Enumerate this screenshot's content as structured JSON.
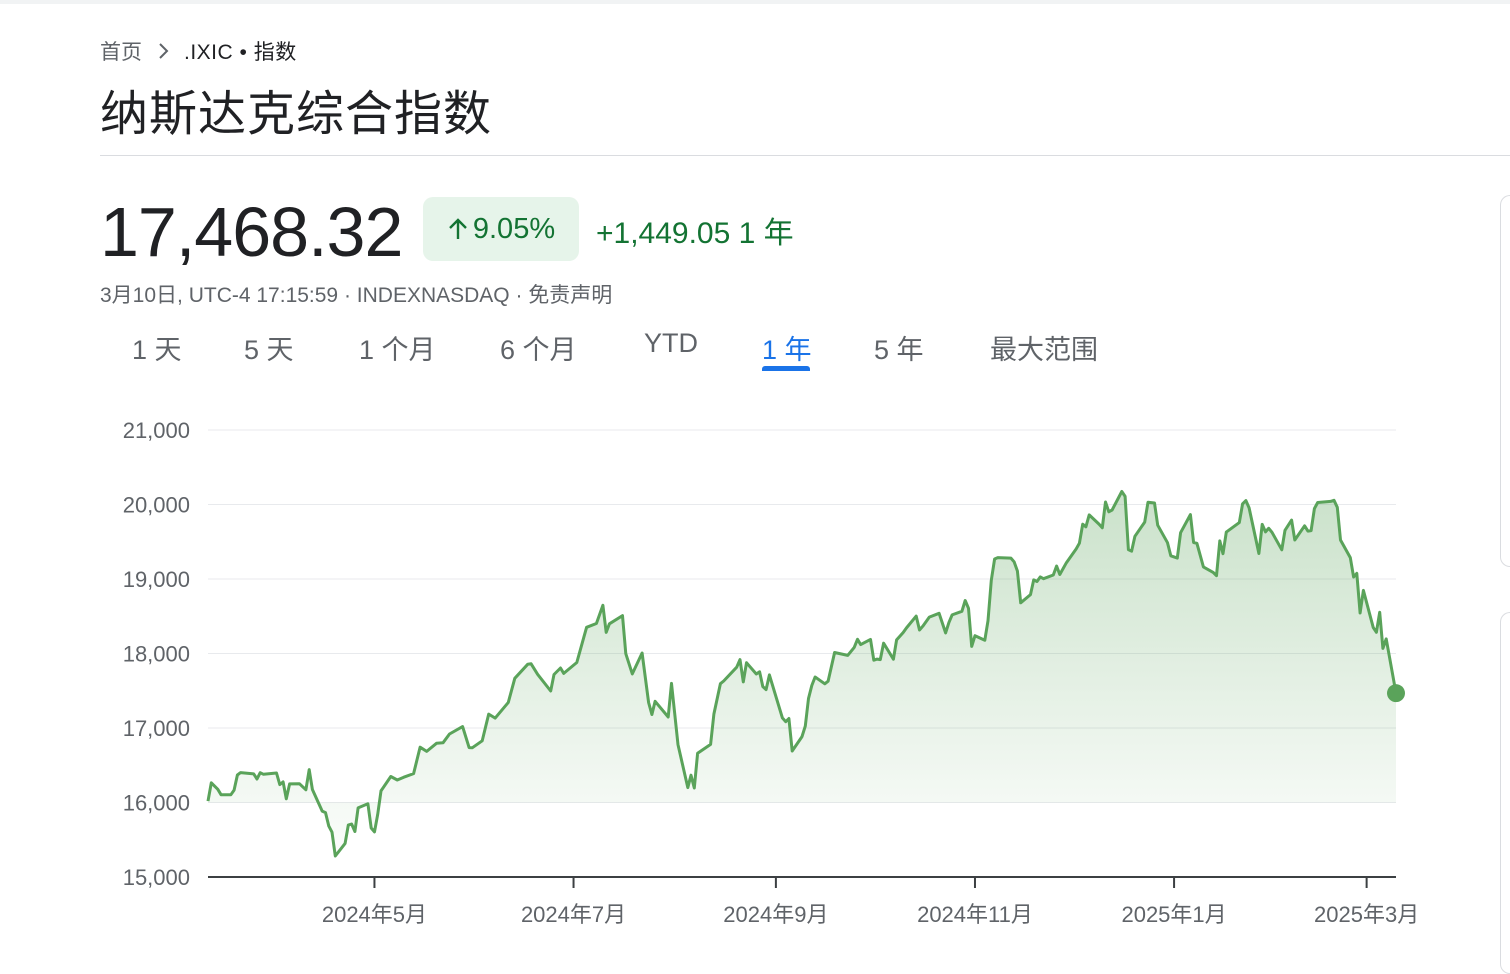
{
  "breadcrumb": {
    "home": "首页",
    "current": ".IXIC • 指数"
  },
  "title": "纳斯达克综合指数",
  "quote": {
    "price": "17,468.32",
    "change_percent": "9.05%",
    "change_abs": "+1,449.05",
    "period": "1 年",
    "meta": "3月10日, UTC-4 17:15:59 · INDEXNASDAQ · 免责声明"
  },
  "tabs": [
    {
      "label": "1 天"
    },
    {
      "label": "5 天"
    },
    {
      "label": "1 个月"
    },
    {
      "label": "6 个月"
    },
    {
      "label": "YTD"
    },
    {
      "label": "1 年",
      "active": true
    },
    {
      "label": "5 年"
    },
    {
      "label": "最大范围"
    }
  ],
  "colors": {
    "up": "#137333",
    "line": "#5aa35a",
    "accent": "#1a73e8",
    "pill_bg": "#e6f4ea"
  },
  "icons": {
    "breadcrumb_sep": "chevron-right-icon",
    "trend": "arrow-up-icon"
  },
  "chart_data": {
    "type": "area",
    "ylim": [
      15000,
      21000
    ],
    "yticks": [
      21000,
      20000,
      19000,
      18000,
      17000,
      16000,
      15000
    ],
    "ytick_labels": [
      "21,000",
      "20,000",
      "19,000",
      "18,000",
      "17,000",
      "16,000",
      "15,000"
    ],
    "xticks": [
      {
        "date": "2024-05-01",
        "label": "2024年5月"
      },
      {
        "date": "2024-07-01",
        "label": "2024年7月"
      },
      {
        "date": "2024-09-01",
        "label": "2024年9月"
      },
      {
        "date": "2024-11-01",
        "label": "2024年11月"
      },
      {
        "date": "2025-01-01",
        "label": "2025年1月"
      },
      {
        "date": "2025-03-01",
        "label": "2025年3月"
      }
    ],
    "grid": true,
    "series": [
      {
        "points": [
          [
            "2024-03-11",
            16019
          ],
          [
            "2024-03-12",
            16265
          ],
          [
            "2024-03-14",
            16177
          ],
          [
            "2024-03-15",
            16103
          ],
          [
            "2024-03-18",
            16103
          ],
          [
            "2024-03-19",
            16166
          ],
          [
            "2024-03-20",
            16369
          ],
          [
            "2024-03-21",
            16401
          ],
          [
            "2024-03-25",
            16384
          ],
          [
            "2024-03-26",
            16316
          ],
          [
            "2024-03-27",
            16400
          ],
          [
            "2024-03-28",
            16379
          ],
          [
            "2024-04-01",
            16396
          ],
          [
            "2024-04-02",
            16240
          ],
          [
            "2024-04-03",
            16277
          ],
          [
            "2024-04-04",
            16049
          ],
          [
            "2024-04-05",
            16249
          ],
          [
            "2024-04-08",
            16253
          ],
          [
            "2024-04-10",
            16170
          ],
          [
            "2024-04-11",
            16442
          ],
          [
            "2024-04-12",
            16175
          ],
          [
            "2024-04-15",
            15885
          ],
          [
            "2024-04-16",
            15865
          ],
          [
            "2024-04-17",
            15683
          ],
          [
            "2024-04-18",
            15601
          ],
          [
            "2024-04-19",
            15282
          ],
          [
            "2024-04-22",
            15451
          ],
          [
            "2024-04-23",
            15697
          ],
          [
            "2024-04-24",
            15712
          ],
          [
            "2024-04-25",
            15611
          ],
          [
            "2024-04-26",
            15928
          ],
          [
            "2024-04-29",
            15983
          ],
          [
            "2024-04-30",
            15658
          ],
          [
            "2024-05-01",
            15605
          ],
          [
            "2024-05-02",
            15840
          ],
          [
            "2024-05-03",
            16156
          ],
          [
            "2024-05-06",
            16349
          ],
          [
            "2024-05-08",
            16302
          ],
          [
            "2024-05-10",
            16340
          ],
          [
            "2024-05-13",
            16388
          ],
          [
            "2024-05-15",
            16742
          ],
          [
            "2024-05-17",
            16686
          ],
          [
            "2024-05-20",
            16795
          ],
          [
            "2024-05-22",
            16801
          ],
          [
            "2024-05-24",
            16920
          ],
          [
            "2024-05-28",
            17019
          ],
          [
            "2024-05-30",
            16737
          ],
          [
            "2024-05-31",
            16735
          ],
          [
            "2024-06-03",
            16828
          ],
          [
            "2024-06-05",
            17187
          ],
          [
            "2024-06-07",
            17133
          ],
          [
            "2024-06-11",
            17343
          ],
          [
            "2024-06-13",
            17667
          ],
          [
            "2024-06-17",
            17857
          ],
          [
            "2024-06-18",
            17862
          ],
          [
            "2024-06-20",
            17721
          ],
          [
            "2024-06-24",
            17497
          ],
          [
            "2024-06-25",
            17718
          ],
          [
            "2024-06-27",
            17805
          ],
          [
            "2024-06-28",
            17733
          ],
          [
            "2024-07-02",
            17879
          ],
          [
            "2024-07-05",
            18352
          ],
          [
            "2024-07-08",
            18403
          ],
          [
            "2024-07-10",
            18647
          ],
          [
            "2024-07-11",
            18283
          ],
          [
            "2024-07-12",
            18398
          ],
          [
            "2024-07-16",
            18509
          ],
          [
            "2024-07-17",
            17997
          ],
          [
            "2024-07-19",
            17726
          ],
          [
            "2024-07-22",
            18007
          ],
          [
            "2024-07-24",
            17342
          ],
          [
            "2024-07-25",
            17181
          ],
          [
            "2024-07-26",
            17358
          ],
          [
            "2024-07-30",
            17147
          ],
          [
            "2024-07-31",
            17599
          ],
          [
            "2024-08-01",
            17194
          ],
          [
            "2024-08-02",
            16776
          ],
          [
            "2024-08-05",
            16200
          ],
          [
            "2024-08-06",
            16366
          ],
          [
            "2024-08-07",
            16195
          ],
          [
            "2024-08-08",
            16660
          ],
          [
            "2024-08-12",
            16780
          ],
          [
            "2024-08-13",
            17188
          ],
          [
            "2024-08-15",
            17594
          ],
          [
            "2024-08-16",
            17631
          ],
          [
            "2024-08-20",
            17816
          ],
          [
            "2024-08-21",
            17918
          ],
          [
            "2024-08-22",
            17619
          ],
          [
            "2024-08-23",
            17877
          ],
          [
            "2024-08-26",
            17725
          ],
          [
            "2024-08-27",
            17754
          ],
          [
            "2024-08-28",
            17556
          ],
          [
            "2024-08-29",
            17516
          ],
          [
            "2024-08-30",
            17713
          ],
          [
            "2024-09-03",
            17136
          ],
          [
            "2024-09-04",
            17084
          ],
          [
            "2024-09-05",
            17128
          ],
          [
            "2024-09-06",
            16691
          ],
          [
            "2024-09-09",
            16885
          ],
          [
            "2024-09-10",
            17026
          ],
          [
            "2024-09-11",
            17396
          ],
          [
            "2024-09-12",
            17570
          ],
          [
            "2024-09-13",
            17684
          ],
          [
            "2024-09-16",
            17593
          ],
          [
            "2024-09-17",
            17628
          ],
          [
            "2024-09-18], 17574"
          ],
          [
            "2024-09-19",
            18014
          ],
          [
            "2024-09-23",
            17974
          ],
          [
            "2024-09-25",
            18082
          ],
          [
            "2024-09-26",
            18190
          ],
          [
            "2024-09-27",
            18119
          ],
          [
            "2024-09-30",
            18189
          ],
          [
            "2024-10-01",
            17910
          ],
          [
            "2024-10-02",
            17925
          ],
          [
            "2024-10-03",
            17918
          ],
          [
            "2024-10-04",
            18138
          ],
          [
            "2024-10-07",
            17923
          ],
          [
            "2024-10-08",
            18182
          ],
          [
            "2024-10-10",
            18282
          ],
          [
            "2024-10-11",
            18342
          ],
          [
            "2024-10-14",
            18502
          ],
          [
            "2024-10-15",
            18315
          ],
          [
            "2024-10-16",
            18367
          ],
          [
            "2024-10-18",
            18489
          ],
          [
            "2024-10-21",
            18540
          ],
          [
            "2024-10-23",
            18276
          ],
          [
            "2024-10-24",
            18415
          ],
          [
            "2024-10-25",
            18518
          ],
          [
            "2024-10-28",
            18567
          ],
          [
            "2024-10-29",
            18712
          ],
          [
            "2024-10-30",
            18607
          ],
          [
            "2024-10-31",
            18095
          ],
          [
            "2024-11-01",
            18239
          ],
          [
            "2024-11-04",
            18179
          ],
          [
            "2024-11-05",
            18439
          ],
          [
            "2024-11-06",
            18983
          ],
          [
            "2024-11-07",
            19269
          ],
          [
            "2024-11-08",
            19287
          ],
          [
            "2024-11-12",
            19281
          ],
          [
            "2024-11-13",
            19231
          ],
          [
            "2024-11-14",
            19107
          ],
          [
            "2024-11-15",
            18680
          ],
          [
            "2024-11-18",
            18791
          ],
          [
            "2024-11-19",
            18988
          ],
          [
            "2024-11-20",
            18967
          ],
          [
            "2024-11-21",
            19028
          ],
          [
            "2024-11-22",
            19004
          ],
          [
            "2024-11-25",
            19054
          ],
          [
            "2024-11-26",
            19175
          ],
          [
            "2024-11-27",
            19061
          ],
          [
            "2024-11-29",
            19219
          ],
          [
            "2024-12-02",
            19404
          ],
          [
            "2024-12-03",
            19480
          ],
          [
            "2024-12-04",
            19735
          ],
          [
            "2024-12-05",
            19701
          ],
          [
            "2024-12-06",
            19860
          ],
          [
            "2024-12-09",
            19737
          ],
          [
            "2024-12-10",
            19687
          ],
          [
            "2024-12-11",
            20034
          ],
          [
            "2024-12-12",
            19902
          ],
          [
            "2024-12-13",
            19926
          ],
          [
            "2024-12-16",
            20174
          ],
          [
            "2024-12-17",
            20109
          ],
          [
            "2024-12-18",
            19393
          ],
          [
            "2024-12-19",
            19373
          ],
          [
            "2024-12-20",
            19573
          ],
          [
            "2024-12-23",
            19764
          ],
          [
            "2024-12-24",
            20031
          ],
          [
            "2024-12-26",
            20020
          ],
          [
            "2024-12-27",
            19722
          ],
          [
            "2024-12-30",
            19487
          ],
          [
            "2024-12-31",
            19311
          ],
          [
            "2025-01-02",
            19280
          ],
          [
            "2025-01-03",
            19622
          ],
          [
            "2025-01-06",
            19865
          ],
          [
            "2025-01-07",
            19490
          ],
          [
            "2025-01-08",
            19479
          ],
          [
            "2025-01-10",
            19162
          ],
          [
            "2025-01-13",
            19088
          ],
          [
            "2025-01-14",
            19044
          ],
          [
            "2025-01-15",
            19511
          ],
          [
            "2025-01-16",
            19339
          ],
          [
            "2025-01-17",
            19630
          ],
          [
            "2025-01-21",
            19757
          ],
          [
            "2025-01-22",
            20009
          ],
          [
            "2025-01-23",
            20053
          ],
          [
            "2025-01-24",
            19955
          ],
          [
            "2025-01-27",
            19342
          ],
          [
            "2025-01-28",
            19733
          ],
          [
            "2025-01-29",
            19632
          ],
          [
            "2025-01-30",
            19681
          ],
          [
            "2025-01-31",
            19627
          ],
          [
            "2025-02-03",
            19392
          ],
          [
            "2025-02-04",
            19654
          ],
          [
            "2025-02-05], 19692"
          ],
          [
            "2025-02-06",
            19791
          ],
          [
            "2025-02-07",
            19523
          ],
          [
            "2025-02-10",
            19714
          ],
          [
            "2025-02-11",
            19643
          ],
          [
            "2025-02-12",
            19650
          ],
          [
            "2025-02-13",
            19945
          ],
          [
            "2025-02-14",
            20027
          ],
          [
            "2025-02-18",
            20041
          ],
          [
            "2025-02-19",
            20056
          ],
          [
            "2025-02-20",
            19962
          ],
          [
            "2025-02-21",
            19524
          ],
          [
            "2025-02-24",
            19287
          ],
          [
            "2025-02-25",
            19027
          ],
          [
            "2025-02-26",
            19075
          ],
          [
            "2025-02-27",
            18544
          ],
          [
            "2025-02-28",
            18847
          ],
          [
            "2025-03-03",
            18350
          ],
          [
            "2025-03-04",
            18285
          ],
          [
            "2025-03-05",
            18553
          ],
          [
            "2025-03-06",
            18069
          ],
          [
            "2025-03-07",
            18196
          ],
          [
            "2025-03-10",
            17468
          ]
        ]
      }
    ]
  }
}
